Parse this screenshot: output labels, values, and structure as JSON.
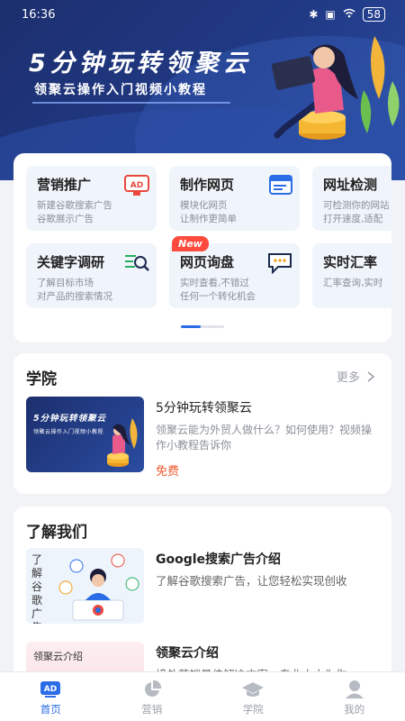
{
  "status_bar": {
    "time": "16:36",
    "battery": "58"
  },
  "banner": {
    "title": "5分钟玩转领聚云",
    "subtitle": "领聚云操作入门视频小教程"
  },
  "tools": [
    {
      "title": "营销推广",
      "desc1": "新建谷歌搜索广告",
      "desc2": "谷歌展示广告",
      "icon": "ad-icon"
    },
    {
      "title": "制作网页",
      "desc1": "模块化网页",
      "desc2": "让制作更简单",
      "icon": "webpage-icon"
    },
    {
      "title": "网址检测",
      "desc1": "可检测你的网站",
      "desc2": "打开速度,适配",
      "icon": ""
    },
    {
      "title": "关键字调研",
      "desc1": "了解目标市场",
      "desc2": "对产品的搜索情况",
      "icon": "keyword-search-icon"
    },
    {
      "title": "网页询盘",
      "desc1": "实时查看,不错过",
      "desc2": "任何一个转化机会",
      "icon": "chat-icon",
      "badge": "New"
    },
    {
      "title": "实时汇率",
      "desc1": "汇率查询,实时",
      "desc2": "",
      "icon": ""
    }
  ],
  "academy": {
    "title": "学院",
    "more": "更多",
    "course": {
      "thumb_title": "5分钟玩转领聚云",
      "thumb_sub": "领聚云操作入门视频小教程",
      "title": "5分钟玩转领聚云",
      "desc": "领聚云能为外贸人做什么？如何使用？视频操作小教程告诉你",
      "price": "免费"
    }
  },
  "about": {
    "title": "了解我们",
    "items": [
      {
        "thumb_text": "了解谷歌广告",
        "title": "Google搜索广告介绍",
        "desc": "了解谷歌搜索广告，让您轻松实现创收"
      },
      {
        "thumb_text": "领聚云介绍",
        "title": "领聚云介绍",
        "desc": "境外营销最佳解决方案，专业人士为你"
      }
    ]
  },
  "nav": [
    {
      "label": "首页",
      "icon": "ad-home-icon",
      "active": true
    },
    {
      "label": "营销",
      "icon": "pie-chart-icon",
      "active": false
    },
    {
      "label": "学院",
      "icon": "graduation-cap-icon",
      "active": false
    },
    {
      "label": "我的",
      "icon": "user-icon",
      "active": false
    }
  ],
  "colors": {
    "accent": "#2b6de6",
    "banner": "#213a86",
    "price": "#f0592f",
    "badge": "#ff4b3e"
  }
}
